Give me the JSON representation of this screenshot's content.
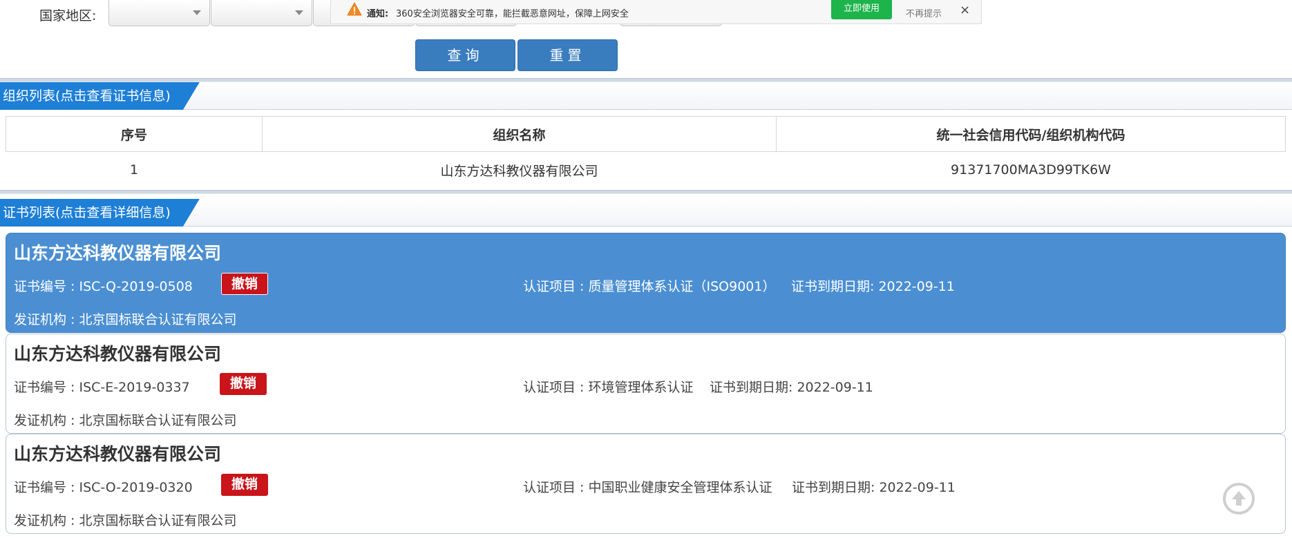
{
  "filter": {
    "region_label": "国家地区:",
    "buttons": {
      "query": "查询",
      "reset": "重置"
    }
  },
  "notification": {
    "label": "通知:",
    "text": "360安全浏览器安全可靠，能拦截恶意网址，保障上网安全",
    "use_now": "立即使用",
    "dont_show": "不再提示",
    "close": "×",
    "accent_color": "#1cb44b"
  },
  "org_section": {
    "title": "组织列表(点击查看证书信息)",
    "columns": [
      "序号",
      "组织名称",
      "统一社会信用代码/组织机构代码"
    ],
    "rows": [
      [
        "1",
        "山东方达科教仪器有限公司",
        "91371700MA3D99TK6W"
      ]
    ]
  },
  "cert_section": {
    "title": "证书列表(点击查看详细信息)",
    "certificates": [
      {
        "org": "山东方达科教仪器有限公司",
        "cert_no": "证书编号 : ISC-Q-2019-0508",
        "status": "撤销",
        "project": "认证项目 : 质量管理体系认证（ISO9001）",
        "expiry": "证书到期日期: 2022-09-11",
        "issuer": "发证机构 : 北京国标联合认证有限公司",
        "selected": true
      },
      {
        "org": "山东方达科教仪器有限公司",
        "cert_no": "证书编号 : ISC-E-2019-0337",
        "status": "撤销",
        "project": "认证项目 : 环境管理体系认证",
        "expiry": "证书到期日期: 2022-09-11",
        "issuer": "发证机构 : 北京国标联合认证有限公司",
        "selected": false
      },
      {
        "org": "山东方达科教仪器有限公司",
        "cert_no": "证书编号 : ISC-O-2019-0320",
        "status": "撤销",
        "project": "认证项目 : 中国职业健康安全管理体系认证",
        "expiry": "证书到期日期: 2022-09-11",
        "issuer": "发证机构 : 北京国标联合认证有限公司",
        "selected": false
      }
    ]
  },
  "colors": {
    "brand_blue": "#1e7fd6",
    "selected_card": "#4b8fd2",
    "revoked_badge": "#c9141b"
  },
  "icons": {
    "warning": "warning-icon",
    "back_to_top": "back-to-top-icon"
  }
}
